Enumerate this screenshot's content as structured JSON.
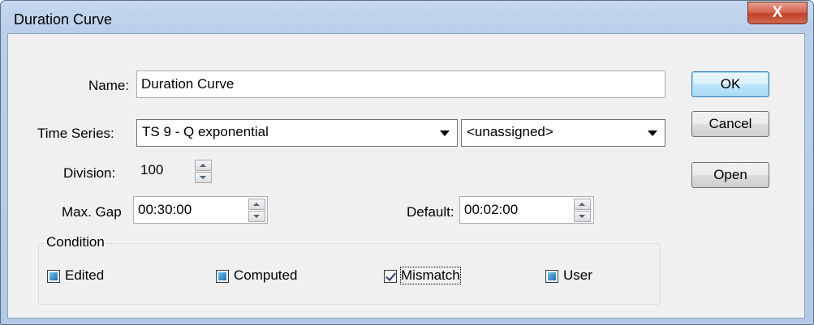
{
  "window": {
    "title": "Duration Curve",
    "close_label": "X"
  },
  "form": {
    "name_label": "Name:",
    "name_value": "Duration Curve",
    "time_series_label": "Time Series:",
    "time_series_value": "TS 9 - Q exponential",
    "secondary_value": "<unassigned>",
    "division_label": "Division:",
    "division_value": "100",
    "max_gap_label": "Max. Gap",
    "max_gap_value": "00:30:00",
    "default_label": "Default:",
    "default_value": "00:02:00"
  },
  "buttons": {
    "ok": "OK",
    "cancel": "Cancel",
    "open": "Open"
  },
  "condition": {
    "title": "Condition",
    "items": [
      {
        "label": "Edited",
        "state": "indeterminate"
      },
      {
        "label": "Computed",
        "state": "indeterminate"
      },
      {
        "label": "Mismatch",
        "state": "checked"
      },
      {
        "label": "User",
        "state": "indeterminate"
      }
    ]
  }
}
